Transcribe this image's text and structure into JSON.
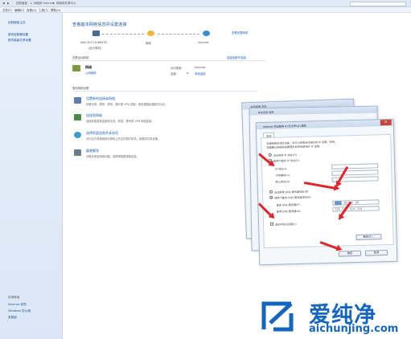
{
  "window": {
    "breadcrumb": [
      "控制面板",
      "网络和 Internet",
      "网络和共享中心"
    ],
    "menu": [
      "文件(F)",
      "编辑(E)",
      "查看(V)",
      "工具(T)",
      "帮助(H)"
    ]
  },
  "sidebar": {
    "home": "控制面板主页",
    "links": [
      "更改适配器设置",
      "更改高级共享设置"
    ],
    "see_also": "另请参阅",
    "see_also_links": [
      "Internet 选项",
      "Windows 防火墙",
      "家庭组"
    ]
  },
  "main": {
    "title": "查看基本网络信息并设置连接",
    "full_map": "查看完整映射",
    "map_nodes": [
      "WIN-2K7C1H6K67N",
      "(此计算机)",
      "网络",
      "Internet"
    ],
    "active_heading": "查看活动网络",
    "connect_disconnect": "连接或断开连接",
    "network_name": "网络",
    "network_type": "公用网络",
    "access_type_label": "访问类型:",
    "access_type_value": "Internet",
    "connections_label": "连接:",
    "connections_value": "本地连接",
    "change_heading": "更改网络设置",
    "tasks": [
      {
        "title": "设置新的连接或网络",
        "desc": "设置无线、宽带、拨号、临时或 VPN 连接；或设置路由器或访问点。"
      },
      {
        "title": "连接到网络",
        "desc": "连接到或重新连接到无线、有线、拨号或 VPN 网络连接。"
      },
      {
        "title": "选择家庭组和共享选项",
        "desc": "访问位于其他网络计算机上的文件和打印机，或更改共享设置。"
      },
      {
        "title": "疑难解答",
        "desc": "诊断并修复网络问题，或获得故障排除信息。"
      }
    ]
  },
  "dialog": {
    "title": "Internet 协议版本 4 (TCP/IPv4) 属性",
    "tab": "常规",
    "intro_1": "如果网络支持此功能，则可以获取自动指派的 IP 设置。否则，",
    "intro_2": "您需要从网络系统管理员处获得适当的 IP 设置。",
    "auto_ip": "自动获得 IP 地址(O)",
    "manual_ip": "使用下面的 IP 地址(S):",
    "ip_label": "IP 地址(I):",
    "mask_label": "子网掩码(U):",
    "gateway_label": "默认网关(D):",
    "auto_dns": "自动获得 DNS 服务器地址(B)",
    "manual_dns": "使用下面的 DNS 服务器地址(E):",
    "dns1_label": "首选 DNS 服务器(P):",
    "dns2_label": "备用 DNS 服务器(A):",
    "dns1_octets": [
      "119",
      "29",
      "29",
      "29"
    ],
    "dns2_octets": [
      "114",
      "114",
      "114",
      "114"
    ],
    "validate": "退出时验证设置(L)",
    "advanced": "高级(V)...",
    "ok": "确定",
    "cancel": "取消",
    "back_title_1": "本地连接 状态",
    "back_title_2": "本地连接 属性"
  },
  "watermark": {
    "cn": "爱纯净",
    "url": "aichunjing.com",
    "color": "#1566c0"
  }
}
